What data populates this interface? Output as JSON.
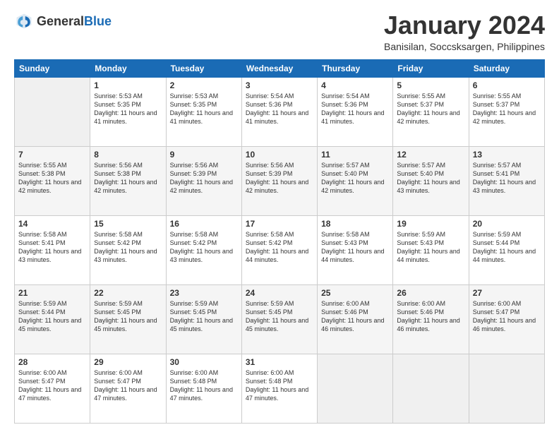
{
  "logo": {
    "general": "General",
    "blue": "Blue"
  },
  "title": "January 2024",
  "subtitle": "Banisilan, Soccsksargen, Philippines",
  "weekdays": [
    "Sunday",
    "Monday",
    "Tuesday",
    "Wednesday",
    "Thursday",
    "Friday",
    "Saturday"
  ],
  "weeks": [
    [
      {
        "day": "",
        "sunrise": "",
        "sunset": "",
        "daylight": ""
      },
      {
        "day": "1",
        "sunrise": "Sunrise: 5:53 AM",
        "sunset": "Sunset: 5:35 PM",
        "daylight": "Daylight: 11 hours and 41 minutes."
      },
      {
        "day": "2",
        "sunrise": "Sunrise: 5:53 AM",
        "sunset": "Sunset: 5:35 PM",
        "daylight": "Daylight: 11 hours and 41 minutes."
      },
      {
        "day": "3",
        "sunrise": "Sunrise: 5:54 AM",
        "sunset": "Sunset: 5:36 PM",
        "daylight": "Daylight: 11 hours and 41 minutes."
      },
      {
        "day": "4",
        "sunrise": "Sunrise: 5:54 AM",
        "sunset": "Sunset: 5:36 PM",
        "daylight": "Daylight: 11 hours and 41 minutes."
      },
      {
        "day": "5",
        "sunrise": "Sunrise: 5:55 AM",
        "sunset": "Sunset: 5:37 PM",
        "daylight": "Daylight: 11 hours and 42 minutes."
      },
      {
        "day": "6",
        "sunrise": "Sunrise: 5:55 AM",
        "sunset": "Sunset: 5:37 PM",
        "daylight": "Daylight: 11 hours and 42 minutes."
      }
    ],
    [
      {
        "day": "7",
        "sunrise": "Sunrise: 5:55 AM",
        "sunset": "Sunset: 5:38 PM",
        "daylight": "Daylight: 11 hours and 42 minutes."
      },
      {
        "day": "8",
        "sunrise": "Sunrise: 5:56 AM",
        "sunset": "Sunset: 5:38 PM",
        "daylight": "Daylight: 11 hours and 42 minutes."
      },
      {
        "day": "9",
        "sunrise": "Sunrise: 5:56 AM",
        "sunset": "Sunset: 5:39 PM",
        "daylight": "Daylight: 11 hours and 42 minutes."
      },
      {
        "day": "10",
        "sunrise": "Sunrise: 5:56 AM",
        "sunset": "Sunset: 5:39 PM",
        "daylight": "Daylight: 11 hours and 42 minutes."
      },
      {
        "day": "11",
        "sunrise": "Sunrise: 5:57 AM",
        "sunset": "Sunset: 5:40 PM",
        "daylight": "Daylight: 11 hours and 42 minutes."
      },
      {
        "day": "12",
        "sunrise": "Sunrise: 5:57 AM",
        "sunset": "Sunset: 5:40 PM",
        "daylight": "Daylight: 11 hours and 43 minutes."
      },
      {
        "day": "13",
        "sunrise": "Sunrise: 5:57 AM",
        "sunset": "Sunset: 5:41 PM",
        "daylight": "Daylight: 11 hours and 43 minutes."
      }
    ],
    [
      {
        "day": "14",
        "sunrise": "Sunrise: 5:58 AM",
        "sunset": "Sunset: 5:41 PM",
        "daylight": "Daylight: 11 hours and 43 minutes."
      },
      {
        "day": "15",
        "sunrise": "Sunrise: 5:58 AM",
        "sunset": "Sunset: 5:42 PM",
        "daylight": "Daylight: 11 hours and 43 minutes."
      },
      {
        "day": "16",
        "sunrise": "Sunrise: 5:58 AM",
        "sunset": "Sunset: 5:42 PM",
        "daylight": "Daylight: 11 hours and 43 minutes."
      },
      {
        "day": "17",
        "sunrise": "Sunrise: 5:58 AM",
        "sunset": "Sunset: 5:42 PM",
        "daylight": "Daylight: 11 hours and 44 minutes."
      },
      {
        "day": "18",
        "sunrise": "Sunrise: 5:58 AM",
        "sunset": "Sunset: 5:43 PM",
        "daylight": "Daylight: 11 hours and 44 minutes."
      },
      {
        "day": "19",
        "sunrise": "Sunrise: 5:59 AM",
        "sunset": "Sunset: 5:43 PM",
        "daylight": "Daylight: 11 hours and 44 minutes."
      },
      {
        "day": "20",
        "sunrise": "Sunrise: 5:59 AM",
        "sunset": "Sunset: 5:44 PM",
        "daylight": "Daylight: 11 hours and 44 minutes."
      }
    ],
    [
      {
        "day": "21",
        "sunrise": "Sunrise: 5:59 AM",
        "sunset": "Sunset: 5:44 PM",
        "daylight": "Daylight: 11 hours and 45 minutes."
      },
      {
        "day": "22",
        "sunrise": "Sunrise: 5:59 AM",
        "sunset": "Sunset: 5:45 PM",
        "daylight": "Daylight: 11 hours and 45 minutes."
      },
      {
        "day": "23",
        "sunrise": "Sunrise: 5:59 AM",
        "sunset": "Sunset: 5:45 PM",
        "daylight": "Daylight: 11 hours and 45 minutes."
      },
      {
        "day": "24",
        "sunrise": "Sunrise: 5:59 AM",
        "sunset": "Sunset: 5:45 PM",
        "daylight": "Daylight: 11 hours and 45 minutes."
      },
      {
        "day": "25",
        "sunrise": "Sunrise: 6:00 AM",
        "sunset": "Sunset: 5:46 PM",
        "daylight": "Daylight: 11 hours and 46 minutes."
      },
      {
        "day": "26",
        "sunrise": "Sunrise: 6:00 AM",
        "sunset": "Sunset: 5:46 PM",
        "daylight": "Daylight: 11 hours and 46 minutes."
      },
      {
        "day": "27",
        "sunrise": "Sunrise: 6:00 AM",
        "sunset": "Sunset: 5:47 PM",
        "daylight": "Daylight: 11 hours and 46 minutes."
      }
    ],
    [
      {
        "day": "28",
        "sunrise": "Sunrise: 6:00 AM",
        "sunset": "Sunset: 5:47 PM",
        "daylight": "Daylight: 11 hours and 47 minutes."
      },
      {
        "day": "29",
        "sunrise": "Sunrise: 6:00 AM",
        "sunset": "Sunset: 5:47 PM",
        "daylight": "Daylight: 11 hours and 47 minutes."
      },
      {
        "day": "30",
        "sunrise": "Sunrise: 6:00 AM",
        "sunset": "Sunset: 5:48 PM",
        "daylight": "Daylight: 11 hours and 47 minutes."
      },
      {
        "day": "31",
        "sunrise": "Sunrise: 6:00 AM",
        "sunset": "Sunset: 5:48 PM",
        "daylight": "Daylight: 11 hours and 47 minutes."
      },
      {
        "day": "",
        "sunrise": "",
        "sunset": "",
        "daylight": ""
      },
      {
        "day": "",
        "sunrise": "",
        "sunset": "",
        "daylight": ""
      },
      {
        "day": "",
        "sunrise": "",
        "sunset": "",
        "daylight": ""
      }
    ]
  ]
}
